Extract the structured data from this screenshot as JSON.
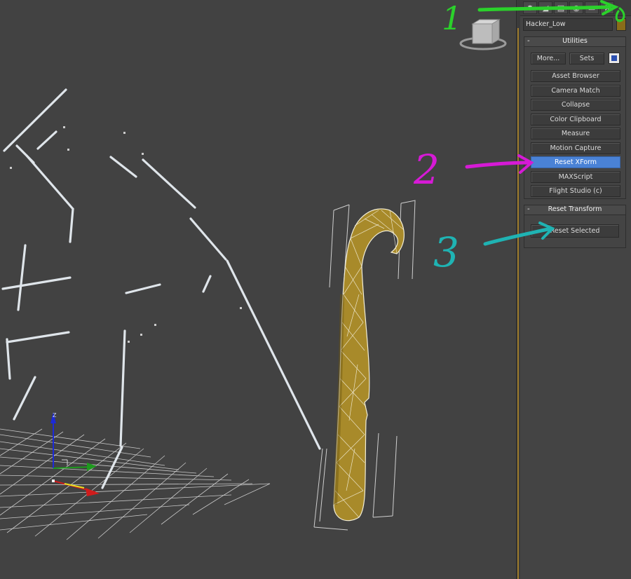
{
  "object_name": "Hacker_Low",
  "object_color": "#8a6d1a",
  "utilities": {
    "title": "Utilities",
    "collapse_symbol": "-",
    "more_label": "More...",
    "sets_label": "Sets",
    "items": [
      "Asset Browser",
      "Camera Match",
      "Collapse",
      "Color Clipboard",
      "Measure",
      "Motion Capture",
      "Reset XForm",
      "MAXScript",
      "Flight Studio (c)"
    ],
    "selected": "Reset XForm"
  },
  "reset_transform": {
    "title": "Reset Transform",
    "collapse_symbol": "-",
    "button_label": "Reset Selected"
  },
  "annotations": {
    "one": "1",
    "two": "2",
    "three": "3",
    "colors": {
      "one": "#2bd12b",
      "two": "#d61ad6",
      "three": "#1fb3b3"
    }
  },
  "gizmo_axes": {
    "z": "Z"
  }
}
